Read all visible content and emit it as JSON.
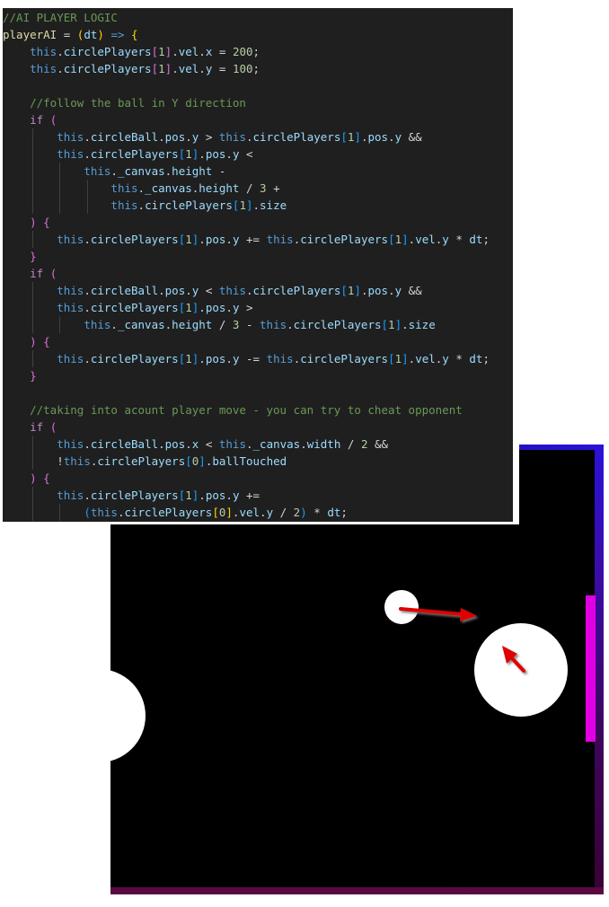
{
  "editor": {
    "language": "javascript",
    "theme_colors": {
      "background": "#1f1f1f",
      "comment": "#6a9955",
      "keyword": "#569cd6",
      "control": "#c586c0",
      "function": "#dcdcaa",
      "property": "#9cdcfe",
      "number": "#b5cea8",
      "bracket1": "#ffd700",
      "bracket2": "#da70d6",
      "bracket3": "#179fff"
    },
    "lines": [
      {
        "indent": 0,
        "tokens": [
          [
            "comment",
            "//AI PLAYER LOGIC"
          ]
        ]
      },
      {
        "indent": 0,
        "tokens": [
          [
            "func",
            "playerAI"
          ],
          [
            "op",
            " = "
          ],
          [
            "b1",
            "("
          ],
          [
            "prop",
            "dt"
          ],
          [
            "b1",
            ")"
          ],
          [
            "op",
            " "
          ],
          [
            "keyword",
            "=>"
          ],
          [
            "op",
            " "
          ],
          [
            "b1",
            "{"
          ]
        ]
      },
      {
        "indent": 1,
        "tokens": [
          [
            "keyword",
            "this"
          ],
          [
            "op",
            "."
          ],
          [
            "prop",
            "circlePlayers"
          ],
          [
            "b2",
            "["
          ],
          [
            "num",
            "1"
          ],
          [
            "b2",
            "]"
          ],
          [
            "op",
            "."
          ],
          [
            "prop",
            "vel"
          ],
          [
            "op",
            "."
          ],
          [
            "prop",
            "x"
          ],
          [
            "op",
            " = "
          ],
          [
            "num",
            "200"
          ],
          [
            "op",
            ";"
          ]
        ]
      },
      {
        "indent": 1,
        "tokens": [
          [
            "keyword",
            "this"
          ],
          [
            "op",
            "."
          ],
          [
            "prop",
            "circlePlayers"
          ],
          [
            "b2",
            "["
          ],
          [
            "num",
            "1"
          ],
          [
            "b2",
            "]"
          ],
          [
            "op",
            "."
          ],
          [
            "prop",
            "vel"
          ],
          [
            "op",
            "."
          ],
          [
            "prop",
            "y"
          ],
          [
            "op",
            " = "
          ],
          [
            "num",
            "100"
          ],
          [
            "op",
            ";"
          ]
        ]
      },
      {
        "indent": 0,
        "tokens": []
      },
      {
        "indent": 1,
        "tokens": [
          [
            "comment",
            "//follow the ball in Y direction"
          ]
        ]
      },
      {
        "indent": 1,
        "tokens": [
          [
            "ctrl",
            "if"
          ],
          [
            "op",
            " "
          ],
          [
            "b2",
            "("
          ]
        ]
      },
      {
        "indent": 2,
        "tokens": [
          [
            "keyword",
            "this"
          ],
          [
            "op",
            "."
          ],
          [
            "prop",
            "circleBall"
          ],
          [
            "op",
            "."
          ],
          [
            "prop",
            "pos"
          ],
          [
            "op",
            "."
          ],
          [
            "prop",
            "y"
          ],
          [
            "op",
            " > "
          ],
          [
            "keyword",
            "this"
          ],
          [
            "op",
            "."
          ],
          [
            "prop",
            "circlePlayers"
          ],
          [
            "b3",
            "["
          ],
          [
            "num",
            "1"
          ],
          [
            "b3",
            "]"
          ],
          [
            "op",
            "."
          ],
          [
            "prop",
            "pos"
          ],
          [
            "op",
            "."
          ],
          [
            "prop",
            "y"
          ],
          [
            "op",
            " &&"
          ]
        ]
      },
      {
        "indent": 2,
        "tokens": [
          [
            "keyword",
            "this"
          ],
          [
            "op",
            "."
          ],
          [
            "prop",
            "circlePlayers"
          ],
          [
            "b3",
            "["
          ],
          [
            "num",
            "1"
          ],
          [
            "b3",
            "]"
          ],
          [
            "op",
            "."
          ],
          [
            "prop",
            "pos"
          ],
          [
            "op",
            "."
          ],
          [
            "prop",
            "y"
          ],
          [
            "op",
            " <"
          ]
        ]
      },
      {
        "indent": 3,
        "tokens": [
          [
            "keyword",
            "this"
          ],
          [
            "op",
            "."
          ],
          [
            "prop",
            "_canvas"
          ],
          [
            "op",
            "."
          ],
          [
            "prop",
            "height"
          ],
          [
            "op",
            " -"
          ]
        ]
      },
      {
        "indent": 4,
        "tokens": [
          [
            "keyword",
            "this"
          ],
          [
            "op",
            "."
          ],
          [
            "prop",
            "_canvas"
          ],
          [
            "op",
            "."
          ],
          [
            "prop",
            "height"
          ],
          [
            "op",
            " / "
          ],
          [
            "num",
            "3"
          ],
          [
            "op",
            " +"
          ]
        ]
      },
      {
        "indent": 4,
        "tokens": [
          [
            "keyword",
            "this"
          ],
          [
            "op",
            "."
          ],
          [
            "prop",
            "circlePlayers"
          ],
          [
            "b3",
            "["
          ],
          [
            "num",
            "1"
          ],
          [
            "b3",
            "]"
          ],
          [
            "op",
            "."
          ],
          [
            "prop",
            "size"
          ]
        ]
      },
      {
        "indent": 1,
        "tokens": [
          [
            "b2",
            ")"
          ],
          [
            "op",
            " "
          ],
          [
            "b2",
            "{"
          ]
        ]
      },
      {
        "indent": 2,
        "tokens": [
          [
            "keyword",
            "this"
          ],
          [
            "op",
            "."
          ],
          [
            "prop",
            "circlePlayers"
          ],
          [
            "b3",
            "["
          ],
          [
            "num",
            "1"
          ],
          [
            "b3",
            "]"
          ],
          [
            "op",
            "."
          ],
          [
            "prop",
            "pos"
          ],
          [
            "op",
            "."
          ],
          [
            "prop",
            "y"
          ],
          [
            "op",
            " += "
          ],
          [
            "keyword",
            "this"
          ],
          [
            "op",
            "."
          ],
          [
            "prop",
            "circlePlayers"
          ],
          [
            "b3",
            "["
          ],
          [
            "num",
            "1"
          ],
          [
            "b3",
            "]"
          ],
          [
            "op",
            "."
          ],
          [
            "prop",
            "vel"
          ],
          [
            "op",
            "."
          ],
          [
            "prop",
            "y"
          ],
          [
            "op",
            " * "
          ],
          [
            "prop",
            "dt"
          ],
          [
            "op",
            ";"
          ]
        ]
      },
      {
        "indent": 1,
        "tokens": [
          [
            "b2",
            "}"
          ]
        ]
      },
      {
        "indent": 1,
        "tokens": [
          [
            "ctrl",
            "if"
          ],
          [
            "op",
            " "
          ],
          [
            "b2",
            "("
          ]
        ]
      },
      {
        "indent": 2,
        "tokens": [
          [
            "keyword",
            "this"
          ],
          [
            "op",
            "."
          ],
          [
            "prop",
            "circleBall"
          ],
          [
            "op",
            "."
          ],
          [
            "prop",
            "pos"
          ],
          [
            "op",
            "."
          ],
          [
            "prop",
            "y"
          ],
          [
            "op",
            " < "
          ],
          [
            "keyword",
            "this"
          ],
          [
            "op",
            "."
          ],
          [
            "prop",
            "circlePlayers"
          ],
          [
            "b3",
            "["
          ],
          [
            "num",
            "1"
          ],
          [
            "b3",
            "]"
          ],
          [
            "op",
            "."
          ],
          [
            "prop",
            "pos"
          ],
          [
            "op",
            "."
          ],
          [
            "prop",
            "y"
          ],
          [
            "op",
            " &&"
          ]
        ]
      },
      {
        "indent": 2,
        "tokens": [
          [
            "keyword",
            "this"
          ],
          [
            "op",
            "."
          ],
          [
            "prop",
            "circlePlayers"
          ],
          [
            "b3",
            "["
          ],
          [
            "num",
            "1"
          ],
          [
            "b3",
            "]"
          ],
          [
            "op",
            "."
          ],
          [
            "prop",
            "pos"
          ],
          [
            "op",
            "."
          ],
          [
            "prop",
            "y"
          ],
          [
            "op",
            " >"
          ]
        ]
      },
      {
        "indent": 3,
        "tokens": [
          [
            "keyword",
            "this"
          ],
          [
            "op",
            "."
          ],
          [
            "prop",
            "_canvas"
          ],
          [
            "op",
            "."
          ],
          [
            "prop",
            "height"
          ],
          [
            "op",
            " / "
          ],
          [
            "num",
            "3"
          ],
          [
            "op",
            " - "
          ],
          [
            "keyword",
            "this"
          ],
          [
            "op",
            "."
          ],
          [
            "prop",
            "circlePlayers"
          ],
          [
            "b3",
            "["
          ],
          [
            "num",
            "1"
          ],
          [
            "b3",
            "]"
          ],
          [
            "op",
            "."
          ],
          [
            "prop",
            "size"
          ]
        ]
      },
      {
        "indent": 1,
        "tokens": [
          [
            "b2",
            ")"
          ],
          [
            "op",
            " "
          ],
          [
            "b2",
            "{"
          ]
        ]
      },
      {
        "indent": 2,
        "tokens": [
          [
            "keyword",
            "this"
          ],
          [
            "op",
            "."
          ],
          [
            "prop",
            "circlePlayers"
          ],
          [
            "b3",
            "["
          ],
          [
            "num",
            "1"
          ],
          [
            "b3",
            "]"
          ],
          [
            "op",
            "."
          ],
          [
            "prop",
            "pos"
          ],
          [
            "op",
            "."
          ],
          [
            "prop",
            "y"
          ],
          [
            "op",
            " -= "
          ],
          [
            "keyword",
            "this"
          ],
          [
            "op",
            "."
          ],
          [
            "prop",
            "circlePlayers"
          ],
          [
            "b3",
            "["
          ],
          [
            "num",
            "1"
          ],
          [
            "b3",
            "]"
          ],
          [
            "op",
            "."
          ],
          [
            "prop",
            "vel"
          ],
          [
            "op",
            "."
          ],
          [
            "prop",
            "y"
          ],
          [
            "op",
            " * "
          ],
          [
            "prop",
            "dt"
          ],
          [
            "op",
            ";"
          ]
        ]
      },
      {
        "indent": 1,
        "tokens": [
          [
            "b2",
            "}"
          ]
        ]
      },
      {
        "indent": 0,
        "tokens": []
      },
      {
        "indent": 1,
        "tokens": [
          [
            "comment",
            "//taking into acount player move - you can try to cheat opponent"
          ]
        ]
      },
      {
        "indent": 1,
        "tokens": [
          [
            "ctrl",
            "if"
          ],
          [
            "op",
            " "
          ],
          [
            "b2",
            "("
          ]
        ]
      },
      {
        "indent": 2,
        "tokens": [
          [
            "keyword",
            "this"
          ],
          [
            "op",
            "."
          ],
          [
            "prop",
            "circleBall"
          ],
          [
            "op",
            "."
          ],
          [
            "prop",
            "pos"
          ],
          [
            "op",
            "."
          ],
          [
            "prop",
            "x"
          ],
          [
            "op",
            " < "
          ],
          [
            "keyword",
            "this"
          ],
          [
            "op",
            "."
          ],
          [
            "prop",
            "_canvas"
          ],
          [
            "op",
            "."
          ],
          [
            "prop",
            "width"
          ],
          [
            "op",
            " / "
          ],
          [
            "num",
            "2"
          ],
          [
            "op",
            " &&"
          ]
        ]
      },
      {
        "indent": 2,
        "tokens": [
          [
            "op",
            "!"
          ],
          [
            "keyword",
            "this"
          ],
          [
            "op",
            "."
          ],
          [
            "prop",
            "circlePlayers"
          ],
          [
            "b3",
            "["
          ],
          [
            "num",
            "0"
          ],
          [
            "b3",
            "]"
          ],
          [
            "op",
            "."
          ],
          [
            "prop",
            "ballTouched"
          ]
        ]
      },
      {
        "indent": 1,
        "tokens": [
          [
            "b2",
            ")"
          ],
          [
            "op",
            " "
          ],
          [
            "b2",
            "{"
          ]
        ]
      },
      {
        "indent": 2,
        "tokens": [
          [
            "keyword",
            "this"
          ],
          [
            "op",
            "."
          ],
          [
            "prop",
            "circlePlayers"
          ],
          [
            "b3",
            "["
          ],
          [
            "num",
            "1"
          ],
          [
            "b3",
            "]"
          ],
          [
            "op",
            "."
          ],
          [
            "prop",
            "pos"
          ],
          [
            "op",
            "."
          ],
          [
            "prop",
            "y"
          ],
          [
            "op",
            " +="
          ]
        ]
      },
      {
        "indent": 3,
        "tokens": [
          [
            "b3",
            "("
          ],
          [
            "keyword",
            "this"
          ],
          [
            "op",
            "."
          ],
          [
            "prop",
            "circlePlayers"
          ],
          [
            "b1",
            "["
          ],
          [
            "num",
            "0"
          ],
          [
            "b1",
            "]"
          ],
          [
            "op",
            "."
          ],
          [
            "prop",
            "vel"
          ],
          [
            "op",
            "."
          ],
          [
            "prop",
            "y"
          ],
          [
            "op",
            " / "
          ],
          [
            "num",
            "2"
          ],
          [
            "b3",
            ")"
          ],
          [
            "op",
            " * "
          ],
          [
            "prop",
            "dt"
          ],
          [
            "op",
            ";"
          ]
        ]
      }
    ]
  },
  "game": {
    "background": "#000000",
    "goal_color": "#e100e1",
    "ball_color": "#ffffff",
    "arrow_color": "#e00000",
    "walls": [
      "top",
      "right",
      "bottom"
    ],
    "circles": [
      "ball",
      "ai-player",
      "human-player"
    ],
    "arrows": [
      "ball-velocity-arrow",
      "ai-player-velocity-arrow"
    ]
  }
}
